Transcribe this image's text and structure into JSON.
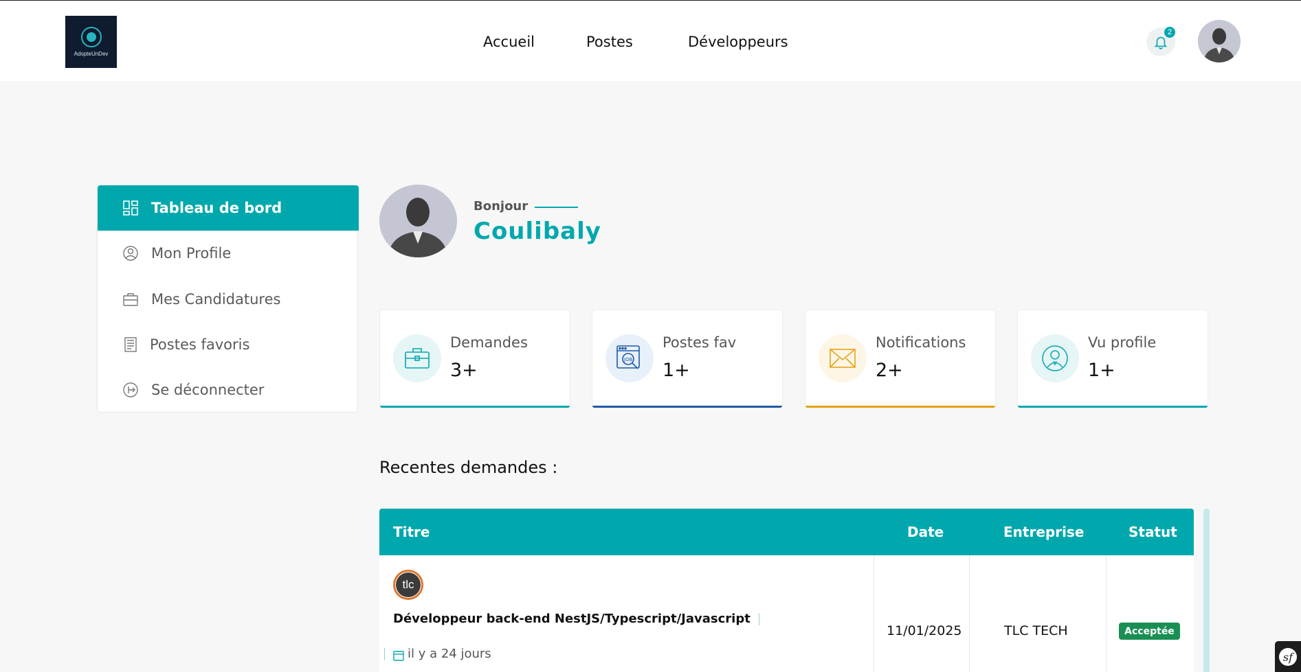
{
  "header": {
    "logo_text": "AdopteUnDev",
    "nav": [
      "Accueil",
      "Postes",
      "Développeurs"
    ],
    "notification_count": "2",
    "icons": {
      "bell": "bell-icon",
      "avatar": "user-avatar"
    }
  },
  "sidebar": {
    "items": [
      {
        "label": "Tableau de bord",
        "icon": "dashboard-icon",
        "active": true
      },
      {
        "label": "Mon Profile",
        "icon": "user-icon",
        "active": false
      },
      {
        "label": "Mes Candidatures",
        "icon": "briefcase-icon",
        "active": false
      },
      {
        "label": "Postes favoris",
        "icon": "document-icon",
        "active": false
      },
      {
        "label": "Se déconnecter",
        "icon": "logout-icon",
        "active": false
      }
    ]
  },
  "greeting": {
    "hello": "Bonjour",
    "name": "Coulibaly"
  },
  "stats": [
    {
      "label": "Demandes",
      "value": "3+",
      "icon": "briefcase-icon",
      "accent": "#00a8ae"
    },
    {
      "label": "Postes fav",
      "value": "1+",
      "icon": "job-search-icon",
      "accent": "#1c5aa6"
    },
    {
      "label": "Notifications",
      "value": "2+",
      "icon": "envelope-icon",
      "accent": "#e5a316"
    },
    {
      "label": "Vu profile",
      "value": "1+",
      "icon": "user-icon",
      "accent": "#00a8ae"
    }
  ],
  "recent": {
    "title": "Recentes demandes :",
    "columns": [
      "Titre",
      "Date",
      "Entreprise",
      "Statut"
    ],
    "rows": [
      {
        "logo_text": "tlc",
        "title": "Développeur back-end NestJS/Typescript/Javascript",
        "time_ago": "il y a 24 jours",
        "date": "11/01/2025",
        "company": "TLC TECH",
        "status": "Acceptée"
      }
    ]
  },
  "colors": {
    "primary": "#00a8ae",
    "background": "#f7f7f7",
    "status_accepted": "#1a8f54"
  }
}
